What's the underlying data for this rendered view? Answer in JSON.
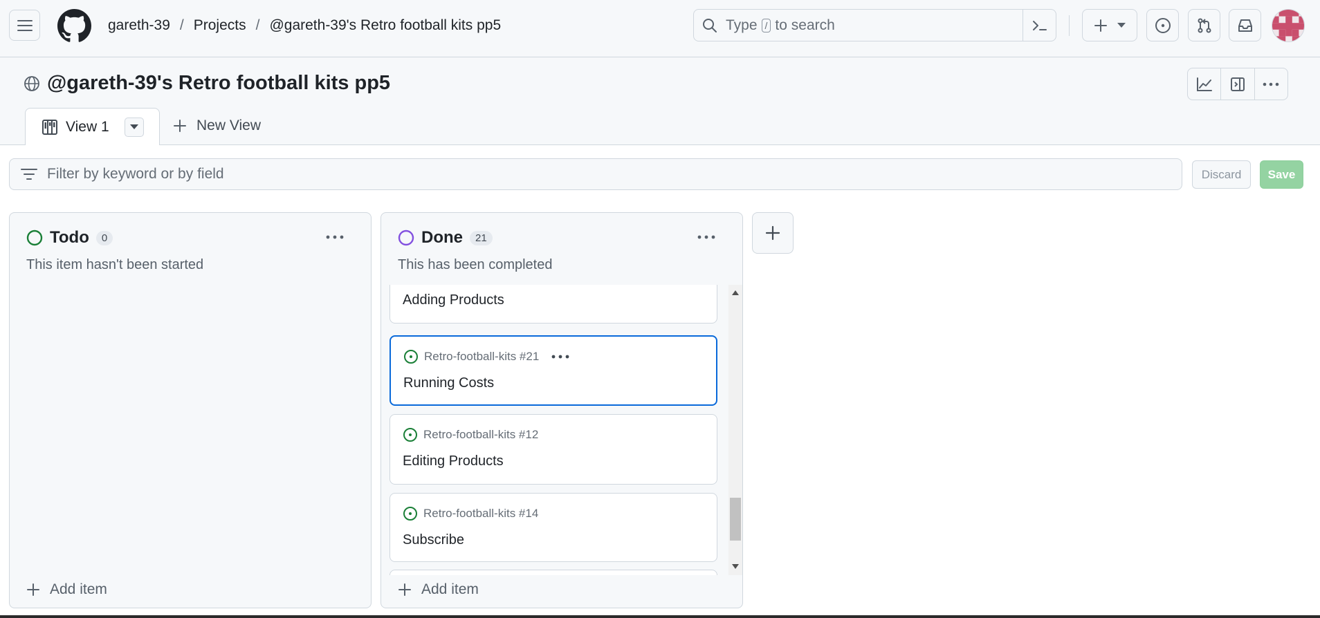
{
  "header": {
    "breadcrumb": [
      "gareth-39",
      "Projects",
      "@gareth-39's Retro football kits pp5"
    ],
    "search_placeholder_before": "Type",
    "search_kbd": "/",
    "search_placeholder_after": "to search"
  },
  "project": {
    "title": "@gareth-39's Retro football kits pp5",
    "tabs": [
      {
        "label": "View 1"
      }
    ],
    "new_view_label": "New View"
  },
  "filter": {
    "placeholder": "Filter by keyword or by field",
    "discard_label": "Discard",
    "save_label": "Save"
  },
  "columns": [
    {
      "title": "Todo",
      "count": "0",
      "description": "This item hasn't been started",
      "status_color": "#1a7f37",
      "add_item_label": "Add item",
      "cards": []
    },
    {
      "title": "Done",
      "count": "21",
      "description": "This has been completed",
      "status_color": "#8250df",
      "add_item_label": "Add item",
      "cards": [
        {
          "ref": "",
          "title": "Adding Products"
        },
        {
          "ref": "Retro-football-kits #21",
          "title": "Running Costs",
          "selected": true
        },
        {
          "ref": "Retro-football-kits #12",
          "title": "Editing Products"
        },
        {
          "ref": "Retro-football-kits #14",
          "title": "Subscribe"
        }
      ]
    }
  ],
  "colors": {
    "accent": "#0969da",
    "open_issue": "#1a7f37",
    "save_disabled": "#94d3a2"
  }
}
